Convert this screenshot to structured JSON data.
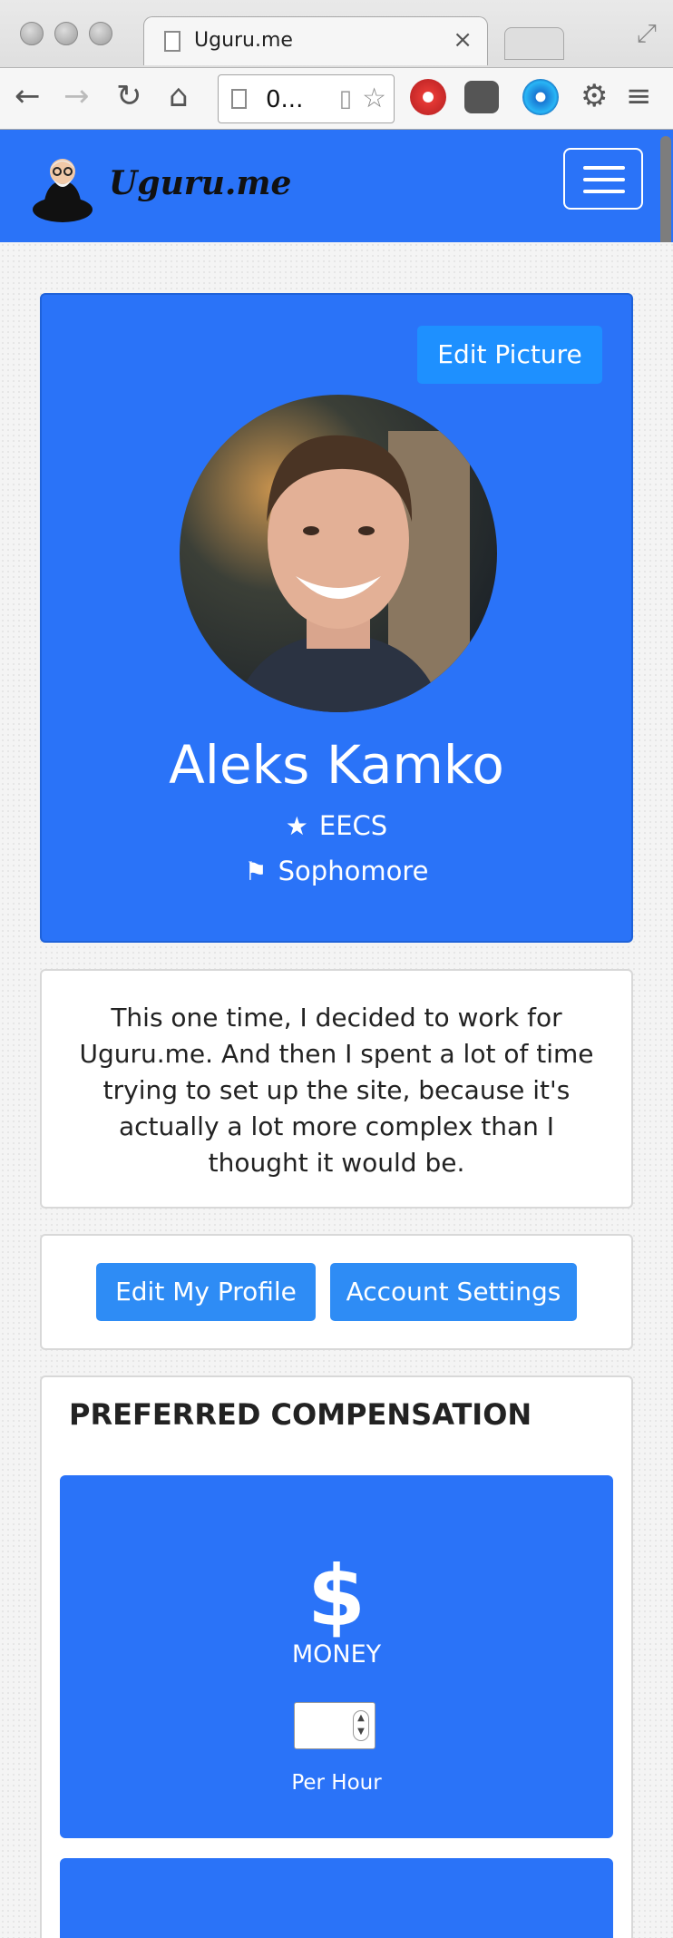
{
  "browser": {
    "tab_title": "Uguru.me",
    "url": "0...",
    "close_glyph": "×"
  },
  "site": {
    "brand": "Uguru.me",
    "accent_color": "#2a73f8"
  },
  "profile": {
    "edit_picture_label": "Edit Picture",
    "name": "Aleks Kamko",
    "major": "EECS",
    "year": "Sophomore",
    "major_icon": "star-icon",
    "year_icon": "flag-icon"
  },
  "bio": {
    "text": "This one time, I decided to work for Uguru.me. And then I spent a lot of time trying to set up the site, because it's actually a lot more complex than I thought it would be."
  },
  "actions": {
    "edit_profile_label": "Edit My Profile",
    "account_settings_label": "Account Settings"
  },
  "compensation": {
    "heading": "PREFERRED COMPENSATION",
    "money_symbol": "$",
    "money_label": "MONEY",
    "rate_value": "",
    "per_hour_label": "Per Hour"
  }
}
